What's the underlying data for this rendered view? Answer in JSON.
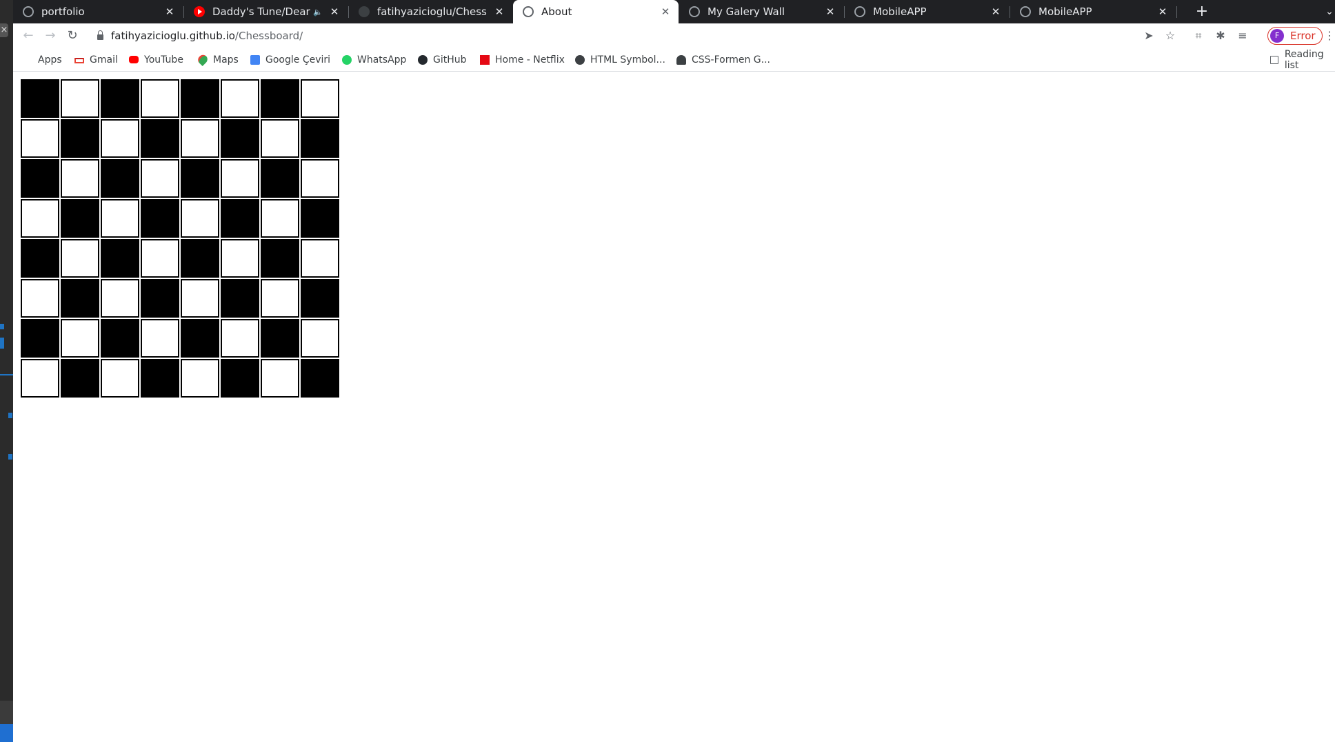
{
  "browser": {
    "tabs": [
      {
        "title": "portfolio",
        "icon": "globe-icon",
        "active": false
      },
      {
        "title": "Daddy's Tune/Dear Ja",
        "icon": "youtube-icon",
        "active": false,
        "audio": true
      },
      {
        "title": "fatihyazicioglu/Chessboa",
        "icon": "github-icon",
        "active": false
      },
      {
        "title": "About",
        "icon": "globe-icon",
        "active": true
      },
      {
        "title": "My Galery Wall",
        "icon": "globe-icon",
        "active": false
      },
      {
        "title": "MobileAPP",
        "icon": "globe-icon",
        "active": false
      },
      {
        "title": "MobileAPP",
        "icon": "globe-icon",
        "active": false
      }
    ],
    "new_tab": "+",
    "tab_search": "⌄",
    "close_glyph": "✕",
    "audio_glyph": "🔈"
  },
  "toolbar": {
    "back": "←",
    "forward": "→",
    "reload": "↻",
    "url_host": "fatihyazicioglu.github.io",
    "url_path": "/Chessboard/",
    "share": "➤",
    "bookmark_star": "☆",
    "screenshot": "⌗",
    "extensions": "✱",
    "media": "≡",
    "profile_initial": "F",
    "profile_label": "Error",
    "menu": "⋮"
  },
  "bookmarks": {
    "items": [
      {
        "label": "Apps",
        "icon": "apps-grid-icon"
      },
      {
        "label": "Gmail",
        "icon": "gmail-icon"
      },
      {
        "label": "YouTube",
        "icon": "youtube-icon"
      },
      {
        "label": "Maps",
        "icon": "maps-pin-icon"
      },
      {
        "label": "Google Çeviri",
        "icon": "translate-icon"
      },
      {
        "label": "WhatsApp",
        "icon": "whatsapp-icon"
      },
      {
        "label": "GitHub",
        "icon": "github-icon"
      },
      {
        "label": "Home - Netflix",
        "icon": "netflix-icon"
      },
      {
        "label": "HTML Symbol...",
        "icon": "globe-icon"
      },
      {
        "label": "CSS-Formen G...",
        "icon": "person-icon"
      }
    ],
    "reading_list": "Reading list"
  },
  "page": {
    "board": {
      "rows": 8,
      "cols": 8,
      "first_square": "black",
      "colors": {
        "black": "#000000",
        "white": "#ffffff"
      }
    }
  },
  "colors": {
    "tabstrip_bg": "#202124",
    "profile_error": "#d93025",
    "avatar": "#8430ce"
  }
}
